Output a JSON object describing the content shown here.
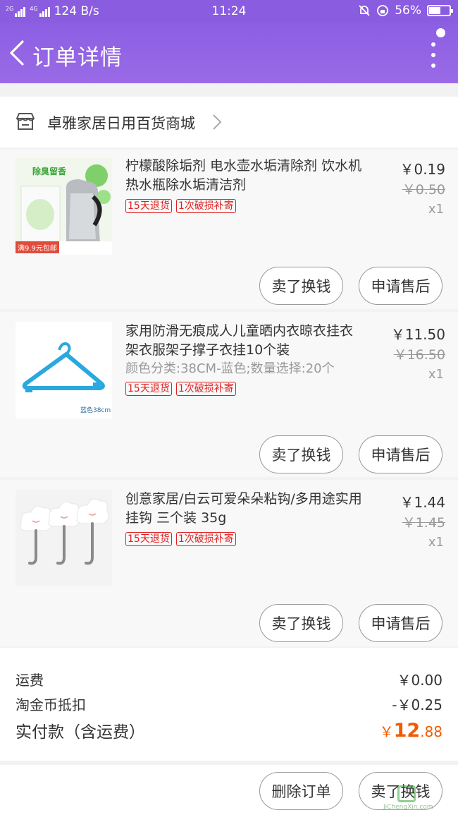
{
  "status_bar": {
    "net_speed": "124 B/s",
    "time": "11:24",
    "battery": "56%",
    "battery_level": 0.56
  },
  "nav": {
    "title": "订单详情"
  },
  "shop": {
    "name": "卓雅家居日用百货商城"
  },
  "items": [
    {
      "title": "柠檬酸除垢剂 电水壶水垢清除剂 饮水机热水瓶除水垢清洁剂",
      "sku": "",
      "tags": [
        "15天退货",
        "1次破损补寄"
      ],
      "price": "￥0.19",
      "original_price": "￥0.50",
      "qty": "x1",
      "image_text_top": "除臭留香",
      "image_text_bottom": "满9.9元包邮",
      "btn_sell": "卖了换钱",
      "btn_aftersale": "申请售后"
    },
    {
      "title": "家用防滑无痕成人儿童晒内衣晾衣挂衣架衣服架子撑子衣挂10个装",
      "sku": "颜色分类:38CM-蓝色;数量选择:20个",
      "tags": [
        "15天退货",
        "1次破损补寄"
      ],
      "price": "￥11.50",
      "original_price": "￥16.50",
      "qty": "x1",
      "image_caption": "蓝色38cm",
      "btn_sell": "卖了换钱",
      "btn_aftersale": "申请售后"
    },
    {
      "title": "创意家居/白云可爱朵朵粘钩/多用途实用挂钩 三个装 35g",
      "sku": "",
      "tags": [
        "15天退货",
        "1次破损补寄"
      ],
      "price": "￥1.44",
      "original_price": "￥1.45",
      "qty": "x1",
      "btn_sell": "卖了换钱",
      "btn_aftersale": "申请售后"
    }
  ],
  "summary": {
    "shipping_label": "运费",
    "shipping_value": "￥0.00",
    "coin_label": "淘金币抵扣",
    "coin_value": "-￥0.25",
    "total_label": "实付款（含运费）",
    "total_currency": "￥",
    "total_int": "12",
    "total_dec": ".88"
  },
  "bottom": {
    "delete_label": "删除订单",
    "sell_label": "卖了换钱"
  },
  "watermark": {
    "text": "JiChengXin.com"
  },
  "colors": {
    "nav_purple": "#8c5ee3",
    "accent_orange": "#f25a00",
    "tag_red": "#e02020"
  }
}
